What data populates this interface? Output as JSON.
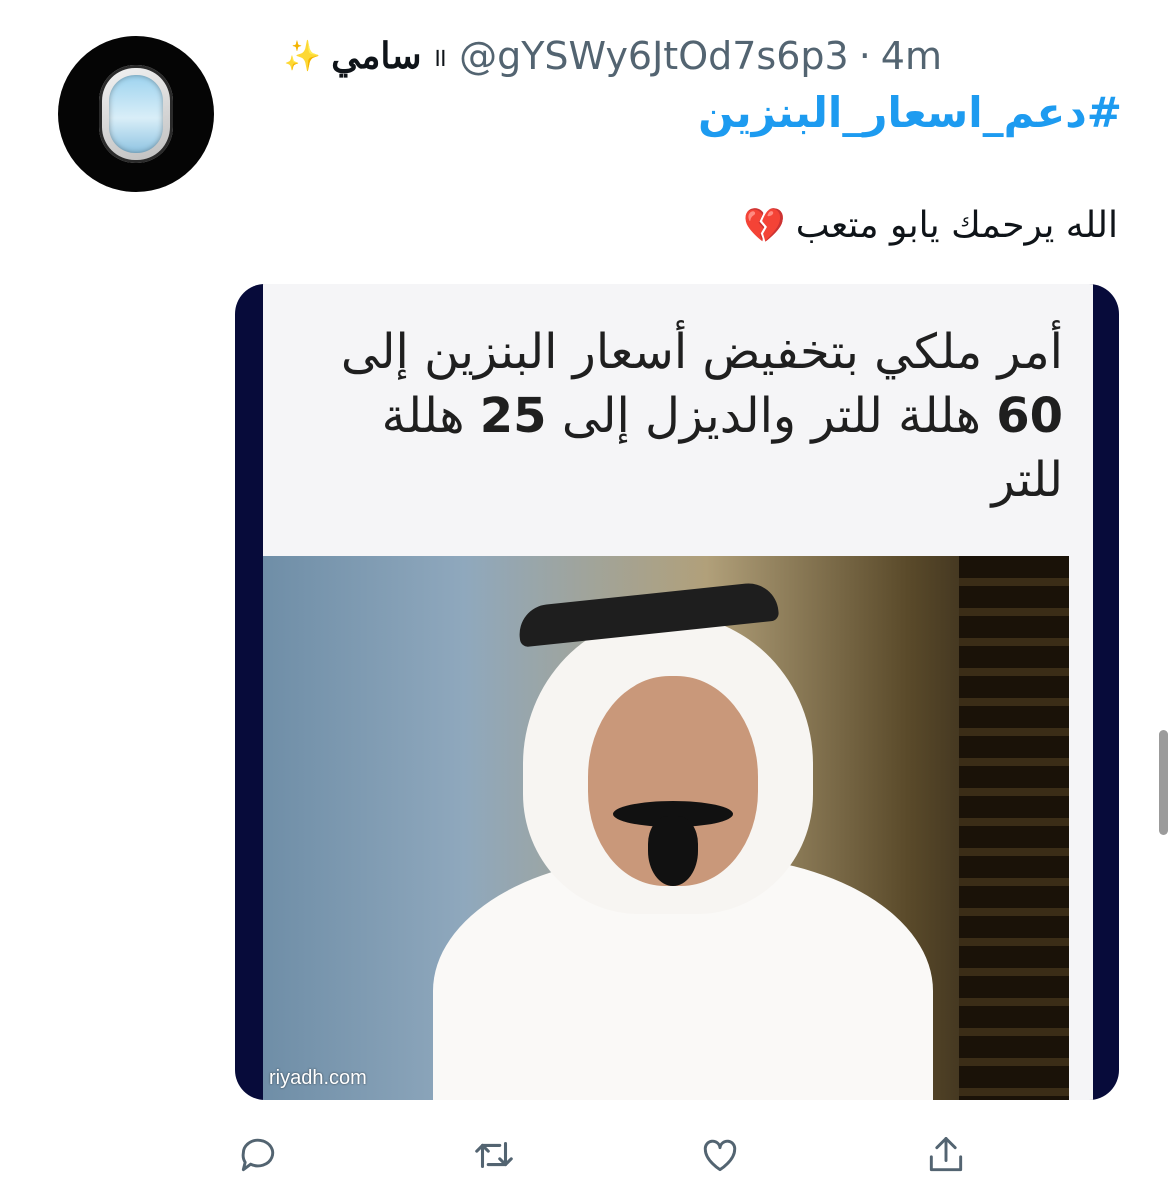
{
  "tweet": {
    "display_name": "سامي",
    "display_name_mark": "॥",
    "name_emoji_icon": "sparkles-icon",
    "handle": "@gYSWy6JtOd7s6p3",
    "separator": "·",
    "time": "4m",
    "hashtag": "#دعم_اسعار_البنزين",
    "text": "الله يرحمك يابو متعب",
    "text_emoji": "💔",
    "text_emoji_icon": "broken-heart-icon"
  },
  "media": {
    "headline_line1": "أمر ملكي بتخفيض أسعار البنزين إلى",
    "headline_line2_num1": "60",
    "headline_line2_mid": "هللة للتر والديزل إلى",
    "headline_line2_num2": "25",
    "headline_line2_end": "هللة",
    "headline_line3": "للتر",
    "watermark": "riyadh.com"
  },
  "actions": [
    {
      "icon": "reply-icon"
    },
    {
      "icon": "retweet-icon"
    },
    {
      "icon": "like-icon"
    },
    {
      "icon": "share-icon"
    }
  ],
  "colors": {
    "link": "#1d9bf0",
    "muted": "#536471",
    "text": "#0f1419",
    "media_border": "#070b3a"
  }
}
